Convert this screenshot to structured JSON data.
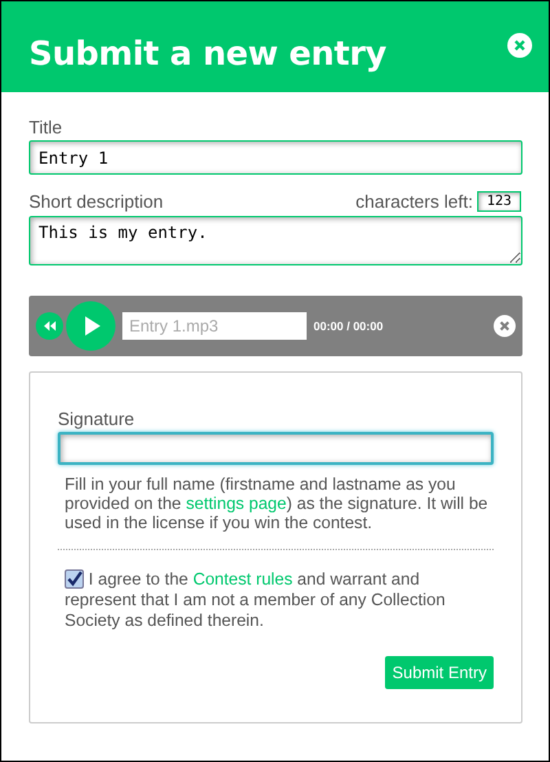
{
  "dialog": {
    "title": "Submit a new entry"
  },
  "fields": [
    {
      "label": "Title",
      "value": "Entry 1"
    },
    {
      "label": "Short description",
      "value": "This is my entry.",
      "counter_label": "characters left:",
      "counter_value": "123"
    }
  ],
  "player": {
    "file_name": "Entry 1.mp3",
    "time": "00:00 / 00:00"
  },
  "signature": {
    "label": "Signature",
    "help_before": "Fill in your full name (firstname and lastname as you provided on the ",
    "help_link": "settings page",
    "help_after": ") as the signature. It will be used in the license if you win the contest."
  },
  "agreement": {
    "checked": true,
    "before": "I agree to the ",
    "link": "Contest rules",
    "after": " and warrant and represent that I am not a member of any Collection Society as defined therein."
  },
  "submit_button": "Submit Entry"
}
